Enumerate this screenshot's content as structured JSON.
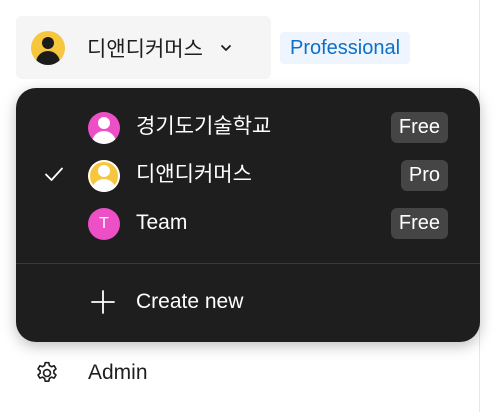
{
  "switcher": {
    "current_team": "디앤디커머스",
    "avatar_icon": "user-avatar-icon",
    "chevron_icon": "chevron-down-icon"
  },
  "plan_badge": "Professional",
  "dropdown": {
    "teams": [
      {
        "name": "경기도기술학교",
        "plan": "Free",
        "avatar": "user-avatar-icon",
        "avatar_color": "#ec4fc6",
        "selected": false
      },
      {
        "name": "디앤디커머스",
        "plan": "Pro",
        "avatar": "user-avatar-icon",
        "avatar_color": "#f7c63f",
        "selected": true
      },
      {
        "name": "Team",
        "plan": "Free",
        "avatar_letter": "T",
        "avatar_color": "#ec4fc6",
        "selected": false
      }
    ],
    "create_label": "Create new",
    "create_icon": "plus-icon",
    "check_icon": "checkmark-icon"
  },
  "admin": {
    "label": "Admin",
    "icon": "gear-icon"
  },
  "colors": {
    "dropdown_bg": "#1e1e1e",
    "badge_bg": "#454545",
    "plan_text": "#0d6fc9",
    "plan_bg": "#eef5fe"
  }
}
